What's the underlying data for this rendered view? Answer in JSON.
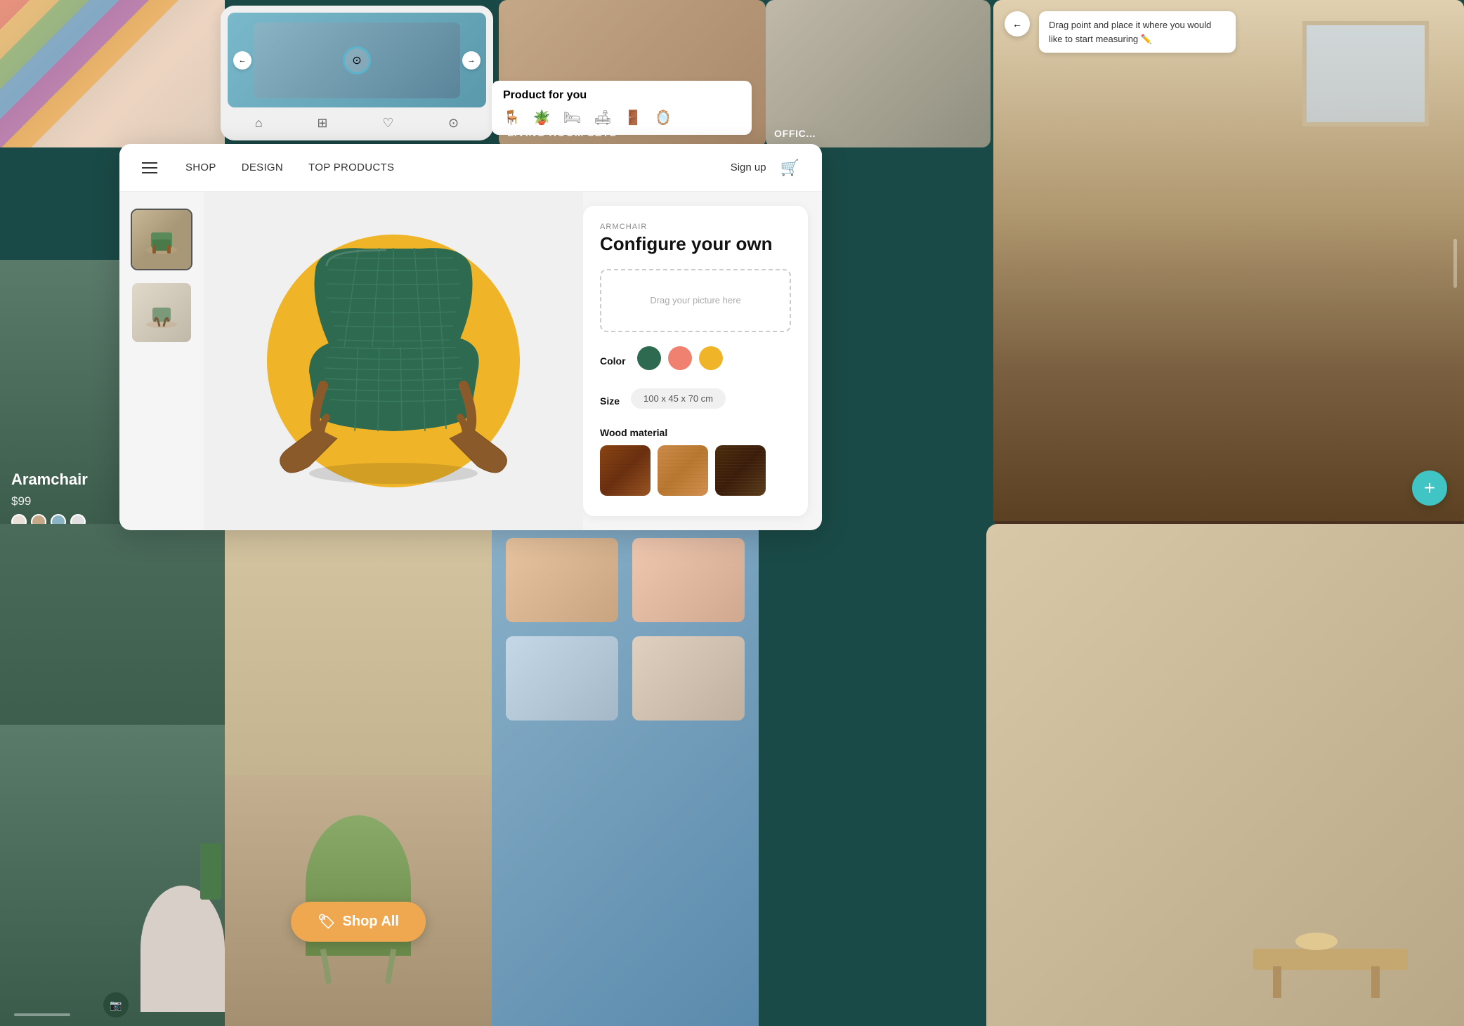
{
  "nav": {
    "menu_label": "☰",
    "shop": "SHOP",
    "design": "DESIGN",
    "top_products": "TOP PRODUCTS",
    "signup": "Sign up",
    "cart_icon": "🛒"
  },
  "product": {
    "subtitle": "ARMCHAIR",
    "title": "Configure your own",
    "drop_zone_text": "Drag your picture here",
    "color_label": "Color",
    "size_label": "Size",
    "size_value": "100 x 45 x 70 cm",
    "wood_label": "Wood material",
    "colors": {
      "green": "#2d6a4f",
      "salmon": "#f08070",
      "yellow": "#f0b429"
    }
  },
  "left_card": {
    "name": "Aramchair",
    "price": "$99"
  },
  "shop_all_button": "Shop All",
  "ar_panel": {
    "tip_text": "Drag point and place it where you would like to start measuring ✏️"
  },
  "living_room": {
    "banner_text": "LIVING ROOM SETS"
  },
  "product_for_you": {
    "title": "Product for you"
  },
  "phone": {
    "scan_hint": "⊙"
  }
}
